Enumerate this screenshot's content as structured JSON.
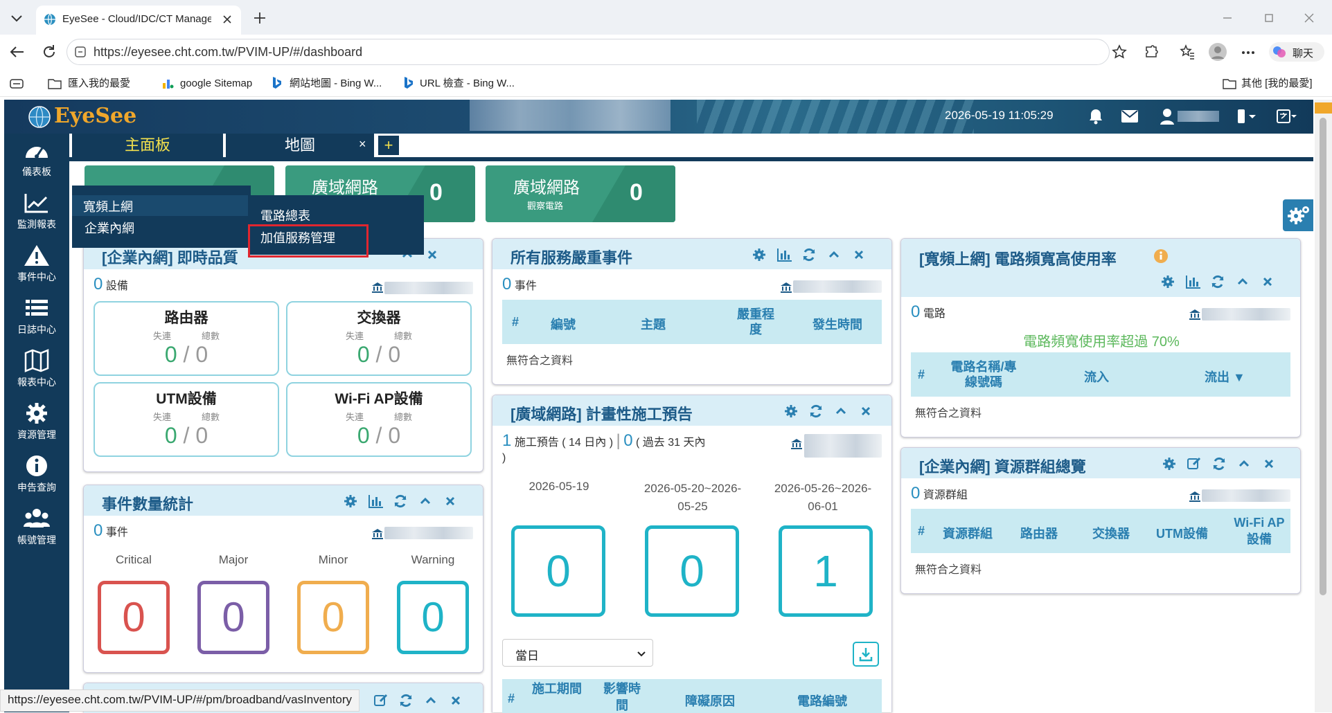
{
  "browser": {
    "tab_title": "EyeSee - Cloud/IDC/CT Manageme",
    "url": "https://eyesee.cht.com.tw/PVIM-UP/#/dashboard",
    "profile_label": "聊天",
    "bookmarks": [
      "匯入我的最愛",
      "google Sitemap",
      "網站地圖 - Bing W...",
      "URL 檢查 - Bing W..."
    ],
    "other_favorites": "其他 [我的最愛]",
    "status_url": "https://eyesee.cht.com.tw/PVIM-UP/#/pm/broadband/vasInventory"
  },
  "header": {
    "logo": "EyeSee",
    "datetime": "2026-05-19 11:05:29"
  },
  "sidebar": {
    "items": [
      "儀表板",
      "監測報表",
      "事件中心",
      "日誌中心",
      "報表中心",
      "資源管理",
      "申告查詢",
      "帳號管理"
    ]
  },
  "tabs": {
    "dashboard": "主面板",
    "map": "地圖",
    "close": "×",
    "add": "+"
  },
  "topcards": [
    {
      "title": "",
      "sub": "",
      "value": ""
    },
    {
      "title": "廣域網路",
      "sub": "",
      "value": "0"
    },
    {
      "title": "廣域網路",
      "sub": "觀察電路",
      "value": "0"
    }
  ],
  "menu": {
    "level1": [
      "寬頻上網",
      "企業內網"
    ],
    "level2": [
      "電路總表",
      "加值服務管理"
    ]
  },
  "realtime": {
    "title": "[企業內網] 即時品質",
    "count": "0",
    "count_label": "設備",
    "devices": [
      {
        "name": "路由器",
        "down_label": "失連",
        "total_label": "總數",
        "down": "0",
        "total": "0"
      },
      {
        "name": "交換器",
        "down_label": "失連",
        "total_label": "總數",
        "down": "0",
        "total": "0"
      },
      {
        "name": "UTM設備",
        "down_label": "失連",
        "total_label": "總數",
        "down": "0",
        "total": "0"
      },
      {
        "name": "Wi-Fi AP設備",
        "down_label": "失連",
        "total_label": "總數",
        "down": "0",
        "total": "0"
      }
    ]
  },
  "severe": {
    "title": "所有服務嚴重事件",
    "count": "0",
    "count_label": "事件",
    "columns": [
      "#",
      "編號",
      "主題",
      "嚴重程度",
      "發生時間"
    ],
    "empty": "無符合之資料"
  },
  "bandwidth": {
    "title": "[寬頻上網] 電路頻寬高使用率",
    "count": "0",
    "count_label": "電路",
    "note": "電路頻寬使用率超過 70%",
    "columns": [
      "#",
      "電路名稱/專線號碼",
      "流入",
      "流出 ▼"
    ],
    "empty": "無符合之資料"
  },
  "events": {
    "title": "事件數量統計",
    "count": "0",
    "count_label": "事件",
    "levels": [
      {
        "name": "Critical",
        "value": "0",
        "color": "#d9534f"
      },
      {
        "name": "Major",
        "value": "0",
        "color": "#7b5ea7"
      },
      {
        "name": "Minor",
        "value": "0",
        "color": "#f0ad4e"
      },
      {
        "name": "Warning",
        "value": "0",
        "color": "#1fb3c7"
      }
    ]
  },
  "construction": {
    "title": "[廣域網路] 計畫性施工預告",
    "count1": "1",
    "label1": "施工預告 ( 14 日內 )",
    "sep": "|",
    "count2": "0",
    "label2": "( 過去 31 天內",
    "label2_end": ")",
    "periods": [
      {
        "range": "2026-05-19",
        "value": "0"
      },
      {
        "range": "2026-05-20~2026-05-25",
        "value": "0"
      },
      {
        "range": "2026-05-26~2026-06-01",
        "value": "1"
      }
    ],
    "select_value": "當日",
    "columns": [
      "#",
      "施工期間",
      "影響時間",
      "障礙原因",
      "電路編號"
    ]
  },
  "resgroups": {
    "title": "[企業內網] 資源群組總覽",
    "count": "0",
    "count_label": "資源群組",
    "columns": [
      "#",
      "資源群組",
      "路由器",
      "交換器",
      "UTM設備",
      "Wi-Fi AP設備"
    ],
    "empty": "無符合之資料"
  }
}
